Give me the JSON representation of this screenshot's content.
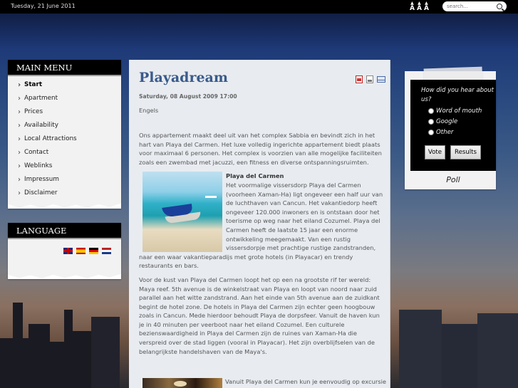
{
  "topbar": {
    "date": "Tuesday, 21 June 2011",
    "font_size_controls": [
      "A",
      "A",
      "A"
    ],
    "search_placeholder": "search..."
  },
  "main_menu": {
    "title": "MAIN MENU",
    "items": [
      {
        "label": "Start",
        "active": true
      },
      {
        "label": "Apartment"
      },
      {
        "label": "Prices"
      },
      {
        "label": "Availability"
      },
      {
        "label": "Local Attractions"
      },
      {
        "label": "Contact"
      },
      {
        "label": "Weblinks"
      },
      {
        "label": "Impressum"
      },
      {
        "label": "Disclaimer"
      }
    ]
  },
  "language": {
    "title": "LANGUAGE",
    "flags": [
      "english-flag-icon",
      "spanish-flag-icon",
      "german-flag-icon",
      "dutch-flag-icon"
    ]
  },
  "article": {
    "title": "Playadream",
    "icons": [
      "pdf-icon",
      "print-icon",
      "email-icon"
    ],
    "date": "Saturday, 08 August 2009 17:00",
    "language": "Engels",
    "p1_intro": "Ons appartement maakt deel uit van het complex Sabbia en bevindt zich in het hart van Playa del Carmen. Het luxe volledig ingerichte appartement biedt plaats voor maximaal 6 personen. Het complex is voorzien van alle mogelijke faciliteiten zoals een zwembad met jacuzzi, een fitness en diverse ontspanningsruimten.",
    "subheading": "Playa del Carmen",
    "p2": "Het voormalige vissersdorp Playa del Carmen (voorheen Xaman-Ha) ligt ongeveer een half uur van de luchthaven van Cancun. Het vakantiedorp heeft ongeveer 120.000 inwoners en is ontstaan door het toerisme op weg naar het eiland Cozumel. Playa del Carmen heeft de laatste 15 jaar een enorme ontwikkeling meegemaakt. Van een rustig vissersdorpje met prachtige rustige zandstranden, naar een waar vakantieparadijs met grote hotels (in Playacar) en trendy restaurants en bars.",
    "p3": "Voor de kust van Playa del Carmen loopt het op een na grootste rif ter wereld: Maya reef. 5th avenue is de winkelstraat van Playa en loopt van noord naar zuid parallel aan het witte zandstrand. Aan het einde van 5th avenue aan de zuidkant begint de hotel zone. De hotels in Playa del Carmen zijn echter geen hoogbouw zoals in Cancun. Mede hierdoor behoudt Playa de dorpsfeer. Vanuit de haven kun je in 40 minuten per veerboot naar het eiland Cozumel. Een culturele bezienswaardigheid in Playa del Carmen zijn de ruines van Xaman-Ha die verspreid over de stad liggen (vooral in Playacar). Het zijn overblijfselen van de belangrijkste handelshaven van de Maya's.",
    "p4_partial": "Vanuit Playa del Carmen kun je eenvoudig op excursie"
  },
  "poll": {
    "question": "How did you hear about us?",
    "options": [
      "Word of mouth",
      "Google",
      "Other"
    ],
    "vote_label": "Vote",
    "results_label": "Results",
    "title": "Poll"
  }
}
